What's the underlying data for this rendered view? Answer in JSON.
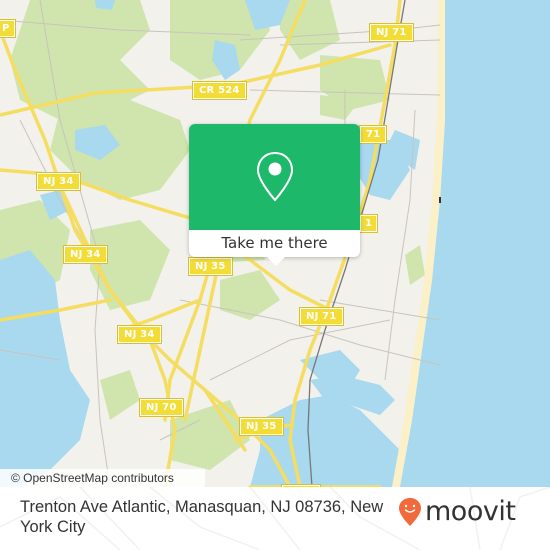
{
  "map": {
    "attribution": "© OpenStreetMap contributors",
    "colors": {
      "land": "#f2f1ec",
      "park": "#cfe5ad",
      "water": "#a8d9ee",
      "road": "#f5dd61",
      "beach": "#fbf0c8",
      "rail": "#777777"
    },
    "route_shields": [
      {
        "id": "nj71-top",
        "label": "NJ 71"
      },
      {
        "id": "cr524",
        "label": "CR 524"
      },
      {
        "id": "nj71-mid",
        "label": "71"
      },
      {
        "id": "nj34-a",
        "label": "NJ 34"
      },
      {
        "id": "nj34-b",
        "label": "NJ 34"
      },
      {
        "id": "nj35-a",
        "label": "NJ 35"
      },
      {
        "id": "nj71-low",
        "label": "NJ 71"
      },
      {
        "id": "nj34-c",
        "label": "NJ 34"
      },
      {
        "id": "nj70",
        "label": "NJ 70"
      },
      {
        "id": "nj35-b",
        "label": "NJ 35"
      },
      {
        "id": "gsp",
        "label": "P"
      },
      {
        "id": "nj35-right",
        "label": "1"
      },
      {
        "id": "bottom",
        "label": ""
      }
    ]
  },
  "popup": {
    "icon": "map-pin-icon",
    "button_label": "Take me there",
    "color": "#1eb86b"
  },
  "footer": {
    "address": "Trenton Ave Atlantic, Manasquan, NJ 08736, New York City",
    "logo_text": "moovit",
    "logo_color": "#f26a3c"
  }
}
